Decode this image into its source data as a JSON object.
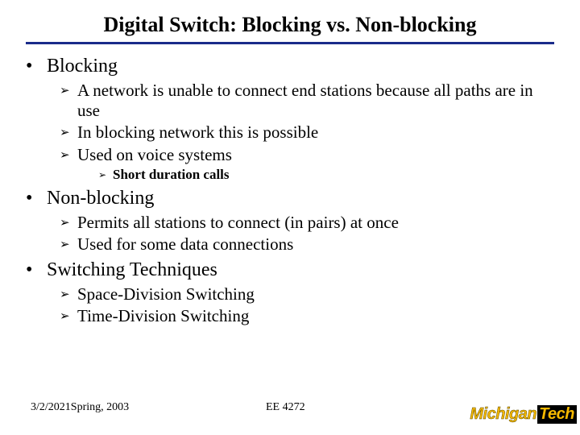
{
  "title": "Digital Switch: Blocking vs. Non-blocking",
  "sections": [
    {
      "heading": "Blocking",
      "items": [
        {
          "text": "A network is unable to connect end stations because all paths are in use"
        },
        {
          "text": "In blocking network this is possible"
        },
        {
          "text": "Used on voice systems",
          "sub": [
            "Short duration calls"
          ]
        }
      ]
    },
    {
      "heading": "Non-blocking",
      "items": [
        {
          "text": "Permits all stations to connect (in pairs) at once"
        },
        {
          "text": "Used for some data connections"
        }
      ]
    },
    {
      "heading": "Switching Techniques",
      "items": [
        {
          "text": "Space-Division Switching"
        },
        {
          "text": "Time-Division Switching"
        }
      ]
    }
  ],
  "footer": {
    "left": "3/2/2021Spring, 2003",
    "center": "EE 4272"
  },
  "logo": {
    "part1": "Michigan",
    "part2": "Tech"
  },
  "glyphs": {
    "dot": "•",
    "arrow": "➢"
  }
}
